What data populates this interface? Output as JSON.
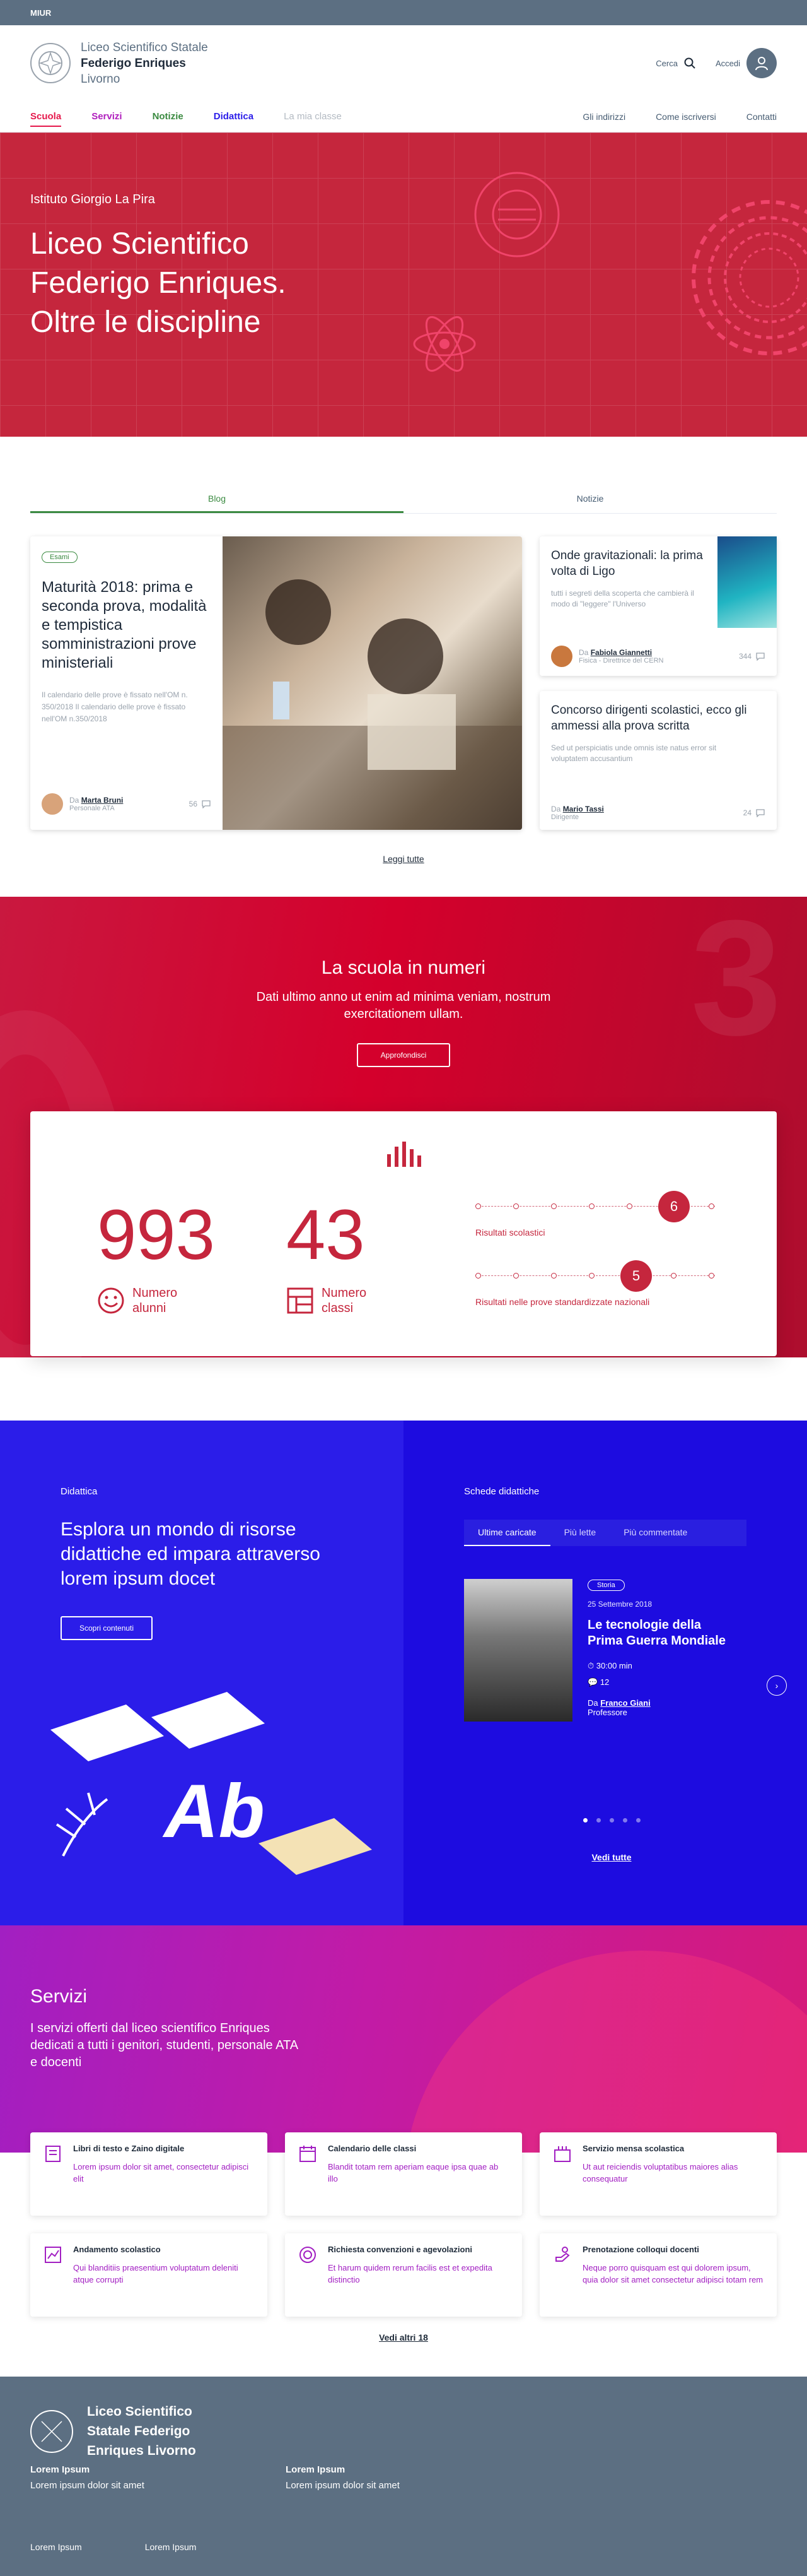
{
  "topbar": {
    "label": "MIUR"
  },
  "header": {
    "school_line1": "Liceo Scientifico Statale",
    "school_line2": "Federigo Enriques",
    "school_line3": "Livorno",
    "search_label": "Cerca",
    "login_label": "Accedi"
  },
  "nav": {
    "left": [
      {
        "label": "Scuola",
        "color": "#e5194c"
      },
      {
        "label": "Servizi",
        "color": "#b01fbd"
      },
      {
        "label": "Notizie",
        "color": "#3a8a40"
      },
      {
        "label": "Didattica",
        "color": "#2b1de9"
      },
      {
        "label": "La mia classe",
        "color": "#b3bac2"
      }
    ],
    "right": [
      "Gli indirizzi",
      "Come iscriversi",
      "Contatti"
    ]
  },
  "hero": {
    "kicker": "Istituto Giorgio La Pira",
    "title": "Liceo Scientifico Federigo Enriques. Oltre le discipline"
  },
  "tabs": [
    "Blog",
    "Notizie"
  ],
  "blog": {
    "main": {
      "badge": "Esami",
      "title": "Maturità 2018: prima e seconda prova, modalità e tempistica somministrazioni prove ministeriali",
      "desc": "Il calendario delle prove è fissato nell'OM n. 350/2018 Il calendario delle prove è fissato nell'OM n.350/2018",
      "author_prefix": "Da",
      "author": "Marta Bruni",
      "role": "Personale ATA",
      "comments": "56"
    },
    "side": [
      {
        "title": "Onde gravitazionali: la prima volta di Ligo",
        "desc": "tutti i segreti della scoperta che cambierà il modo di \"leggere\" l'Universo",
        "author_prefix": "Da",
        "author": "Fabiola Giannetti",
        "role": "Fisica - Direttrice del CERN",
        "comments": "344"
      },
      {
        "title": "Concorso dirigenti scolastici, ecco gli ammessi alla prova scritta",
        "desc": "Sed ut perspiciatis unde omnis iste natus error sit voluptatem accusantium",
        "author_prefix": "Da",
        "author": "Mario Tassi",
        "role": "Dirigente",
        "comments": "24"
      }
    ],
    "read_all": "Leggi tutte"
  },
  "numbers": {
    "title": "La scuola in numeri",
    "subtitle": "Dati ultimo anno ut enim ad minima veniam, nostrum exercitationem ullam.",
    "button": "Approfondisci",
    "stat1_value": "993",
    "stat1_label_1": "Numero",
    "stat1_label_2": "alunni",
    "stat2_value": "43",
    "stat2_label_1": "Numero",
    "stat2_label_2": "classi",
    "result1_value": "6",
    "result1_label": "Risultati scolastici",
    "result2_value": "5",
    "result2_label": "Risultati nelle prove standardizzate nazionali"
  },
  "didattica": {
    "kicker": "Didattica",
    "title": "Esplora un mondo di risorse didattiche ed impara attraverso lorem ipsum docet",
    "button": "Scopri contenuti",
    "right_kicker": "Schede didattiche",
    "tabs": [
      "Ultime caricate",
      "Più lette",
      "Più commentate"
    ],
    "card": {
      "badge": "Storia",
      "date": "25 Settembre 2018",
      "title": "Le tecnologie della Prima Guerra Mondiale",
      "duration": "30:00 min",
      "comments": "12",
      "author_prefix": "Da",
      "author": "Franco Giani",
      "role": "Professore"
    },
    "see_all": "Vedi tutte",
    "art_text": "Ab"
  },
  "servizi": {
    "title": "Servizi",
    "subtitle": "I servizi offerti dal liceo scientifico Enriques dedicati a tutti i genitori, studenti, personale ATA e docenti",
    "cards": [
      {
        "title": "Libri di testo e Zaino digitale",
        "desc": "Lorem ipsum dolor sit amet, consectetur adipisci elit",
        "icon": "book-icon"
      },
      {
        "title": "Calendario delle classi",
        "desc": "Blandit totam rem aperiam eaque ipsa quae ab illo",
        "icon": "calendar-icon"
      },
      {
        "title": "Servizio mensa scolastica",
        "desc": "Ut aut reiciendis voluptatibus maiores alias consequatur",
        "icon": "canteen-icon"
      },
      {
        "title": "Andamento scolastico",
        "desc": "Qui blanditiis praesentium voluptatum deleniti atque corrupti",
        "icon": "chart-icon"
      },
      {
        "title": "Richiesta convenzioni e agevolazioni",
        "desc": "Et harum quidem rerum facilis est et expedita distinctio",
        "icon": "discount-icon"
      },
      {
        "title": "Prenotazione colloqui docenti",
        "desc": "Neque porro quisquam est qui dolorem ipsum, quia dolor sit amet consectetur adipisci totam rem",
        "icon": "hand-icon"
      }
    ],
    "more": "Vedi altri 18"
  },
  "footer": {
    "name_1": "Liceo Scientifico",
    "name_2": "Statale Federigo",
    "name_3": "Enriques Livorno",
    "col1_head": "Lorem Ipsum",
    "col1_text": "Lorem ipsum dolor sit amet",
    "col2_head": "Lorem Ipsum",
    "col2_text": "Lorem ipsum dolor sit amet",
    "bottom_1": "Lorem Ipsum",
    "bottom_2": "Lorem Ipsum"
  }
}
